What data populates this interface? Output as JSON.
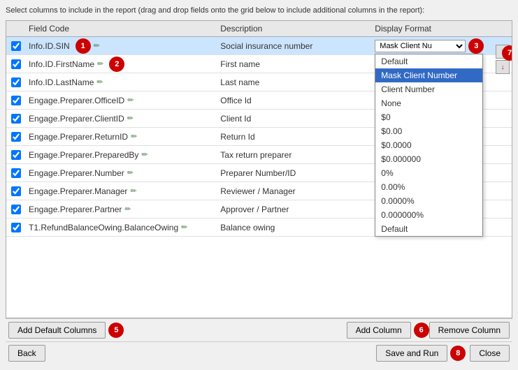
{
  "instruction": "Select columns to include in the report (drag and drop fields onto the grid below to include additional columns in the report):",
  "header": {
    "col_check": "",
    "col_field": "Field Code",
    "col_desc": "Description",
    "col_format": "Display Format"
  },
  "rows": [
    {
      "id": 1,
      "checked": true,
      "field": "Info.ID.SIN",
      "desc": "Social insurance number",
      "format": "Mask Client Nu",
      "selected": true,
      "badge": 1
    },
    {
      "id": 2,
      "checked": true,
      "field": "Info.ID.FirstName",
      "desc": "First name",
      "format": "",
      "selected": false,
      "badge": 2
    },
    {
      "id": 3,
      "checked": true,
      "field": "Info.ID.LastName",
      "desc": "Last name",
      "format": "",
      "selected": false
    },
    {
      "id": 4,
      "checked": true,
      "field": "Engage.Preparer.OfficeID",
      "desc": "Office Id",
      "format": "",
      "selected": false
    },
    {
      "id": 5,
      "checked": true,
      "field": "Engage.Preparer.ClientID",
      "desc": "Client Id",
      "format": "",
      "selected": false
    },
    {
      "id": 6,
      "checked": true,
      "field": "Engage.Preparer.ReturnID",
      "desc": "Return Id",
      "format": "",
      "selected": false
    },
    {
      "id": 7,
      "checked": true,
      "field": "Engage.Preparer.PreparedBy",
      "desc": "Tax return preparer",
      "format": "",
      "selected": false
    },
    {
      "id": 8,
      "checked": true,
      "field": "Engage.Preparer.Number",
      "desc": "Preparer Number/ID",
      "format": "",
      "selected": false
    },
    {
      "id": 9,
      "checked": true,
      "field": "Engage.Preparer.Manager",
      "desc": "Reviewer / Manager",
      "format": "",
      "selected": false
    },
    {
      "id": 10,
      "checked": true,
      "field": "Engage.Preparer.Partner",
      "desc": "Approver / Partner",
      "format": "",
      "selected": false
    },
    {
      "id": 11,
      "checked": true,
      "field": "T1.RefundBalanceOwing.BalanceOwing",
      "desc": "Balance owing",
      "format": "",
      "selected": false
    }
  ],
  "dropdown": {
    "visible": true,
    "options": [
      {
        "label": "Default",
        "highlighted": false
      },
      {
        "label": "Mask Client Number",
        "highlighted": true
      },
      {
        "label": "Client Number",
        "highlighted": false
      },
      {
        "label": "None",
        "highlighted": false
      },
      {
        "label": "$0",
        "highlighted": false
      },
      {
        "label": "$0.00",
        "highlighted": false
      },
      {
        "label": "$0.0000",
        "highlighted": false
      },
      {
        "label": "$0.000000",
        "highlighted": false
      },
      {
        "label": "0%",
        "highlighted": false
      },
      {
        "label": "0.00%",
        "highlighted": false
      },
      {
        "label": "0.0000%",
        "highlighted": false
      },
      {
        "label": "0.000000%",
        "highlighted": false
      },
      {
        "label": "Default",
        "highlighted": false
      }
    ]
  },
  "badges": {
    "badge3": "3",
    "badge5": "5",
    "badge6": "6",
    "badge7": "7",
    "badge8": "8"
  },
  "buttons": {
    "add_default": "Add Default Columns",
    "add_column": "Add Column",
    "remove_column": "Remove Column",
    "back": "Back",
    "save_run": "Save and Run",
    "close": "Close",
    "arrow_up": "↑",
    "arrow_down": "↓"
  }
}
